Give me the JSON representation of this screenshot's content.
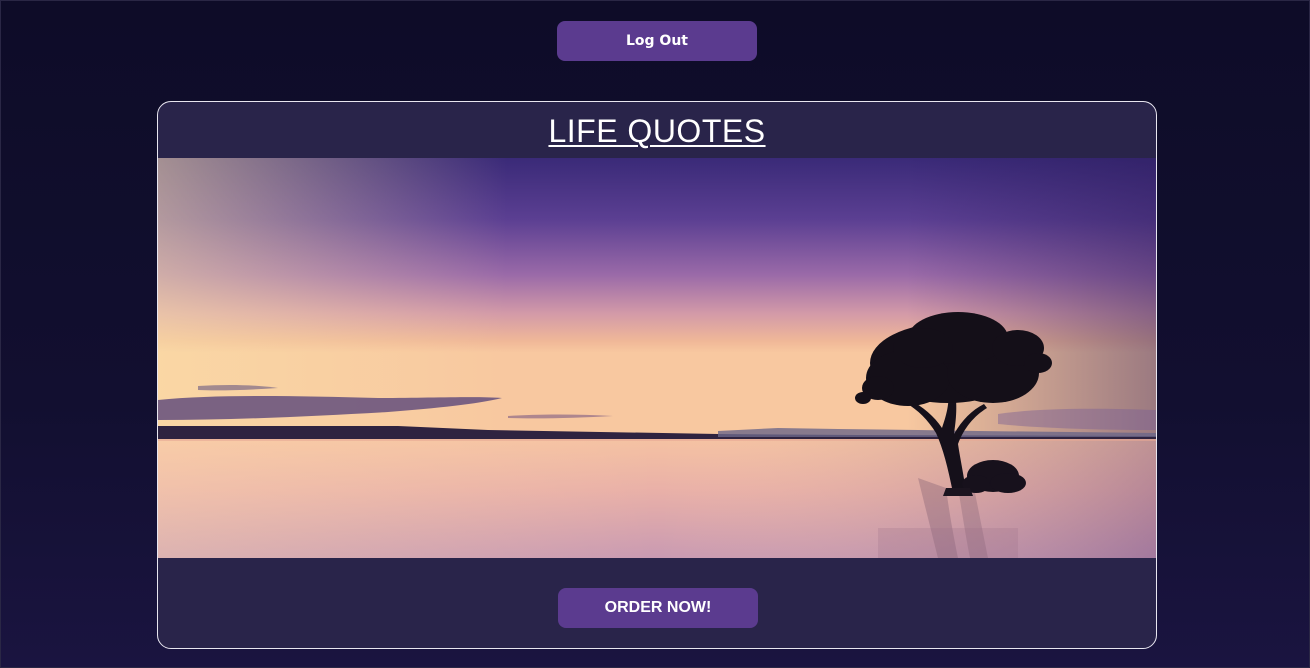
{
  "header": {
    "logout_label": "Log Out"
  },
  "card": {
    "title": "LIFE QUOTES",
    "image_alt": "Lone tree standing in a calm lake at sunset with a purple sky",
    "order_label": "ORDER NOW!"
  },
  "colors": {
    "background": "#120f30",
    "card": "#29244a",
    "button": "#5b3b8f",
    "text": "#ffffff"
  }
}
